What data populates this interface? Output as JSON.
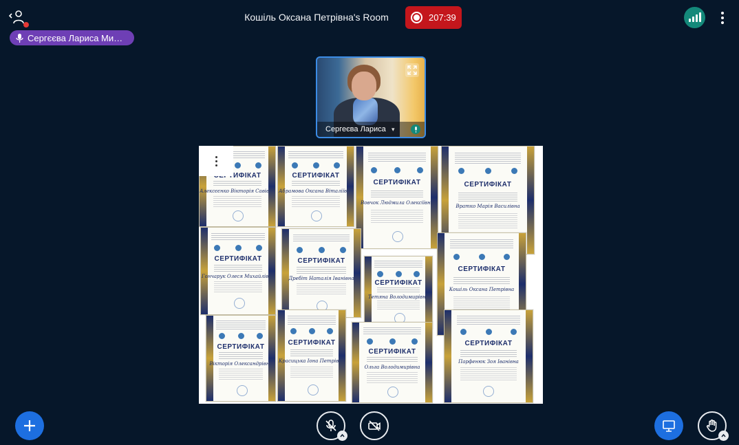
{
  "header": {
    "room_title": "Кошіль Оксана Петрівна's Room",
    "recording_time": "207:39"
  },
  "talker": {
    "name": "Сергєєва Лариса Ми…"
  },
  "webcam": {
    "user_name": "Сергеєва Лариса"
  },
  "slide": {
    "certificates": [
      {
        "title": "СЕРТИФІКАТ",
        "name": "Алексєєнко Вікторія Савівна"
      },
      {
        "title": "СЕРТИФІКАТ",
        "name": "Абрамова Оксана Віталіївна"
      },
      {
        "title": "СЕРТИФІКАТ",
        "name": "Вовчок Людмила Олексіївна"
      },
      {
        "title": "СЕРТИФІКАТ",
        "name": "Вратко Марія Василівна"
      },
      {
        "title": "СЕРТИФІКАТ",
        "name": "Гончарук Олеся Михайлівна"
      },
      {
        "title": "СЕРТИФІКАТ",
        "name": "Дребіт Наталія Іванівна"
      },
      {
        "title": "СЕРТИФІКАТ",
        "name": "Тетяна Володимирівна"
      },
      {
        "title": "СЕРТИФІКАТ",
        "name": "Кошіль Оксана Петрівна"
      },
      {
        "title": "СЕРТИФІКАТ",
        "name": "Вікторія Олександрівна"
      },
      {
        "title": "СЕРТИФІКАТ",
        "name": "Красицька Іона Петрівна"
      },
      {
        "title": "СЕРТИФІКАТ",
        "name": "Ольга Володимирівна"
      },
      {
        "title": "СЕРТИФІКАТ",
        "name": "Парфенюк Зоя Іванівна"
      }
    ]
  },
  "colors": {
    "background": "#06172a",
    "record": "#c4161c",
    "connection": "#14897a",
    "talker": "#6e3fb5",
    "primary": "#1d6fe0"
  },
  "icons": {
    "users": "users-icon",
    "record": "record-icon",
    "connection": "connection-status-icon",
    "options": "more-options-icon",
    "mic": "microphone-icon",
    "expand": "fullscreen-icon",
    "add": "plus-icon",
    "mic_off": "microphone-off-icon",
    "camera_off": "camera-off-icon",
    "present": "presentation-icon",
    "hand": "raise-hand-icon"
  }
}
